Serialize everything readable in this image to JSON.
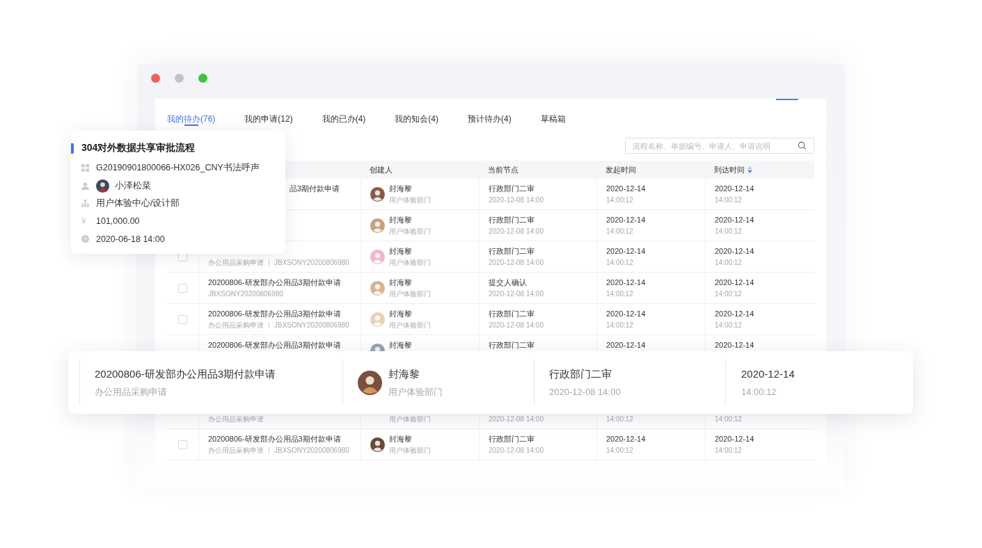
{
  "window": {
    "controls": [
      {
        "kind": "close"
      },
      {
        "kind": "minimize"
      },
      {
        "kind": "maximize"
      }
    ]
  },
  "tabs": [
    {
      "label": "我的待办(76)",
      "selected": true
    },
    {
      "label": "我的申请(12)",
      "selected": false
    },
    {
      "label": "我的已办(4)",
      "selected": false
    },
    {
      "label": "我的知会(4)",
      "selected": false
    },
    {
      "label": "预计待办(4)",
      "selected": false
    },
    {
      "label": "草稿箱",
      "selected": false
    }
  ],
  "search": {
    "placeholder": "流程名称、单据编号、申请人、申请说明"
  },
  "table": {
    "columns": [
      {
        "label": "创建人"
      },
      {
        "label": "当前节点"
      },
      {
        "label": "发起时间"
      },
      {
        "label": "到达时间",
        "sortable": true
      }
    ],
    "rows": [
      {
        "kind": "cut",
        "title": "品3期付款申请",
        "creator": "封海黎",
        "dept": "用户体验部门",
        "node": "行政部门二审",
        "node_time": "2020-12-08 14:00",
        "start_date": "2020-12-14",
        "start_time": "14:00:12",
        "arrive_date": "2020-12-14",
        "arrive_time": "14:00:12"
      },
      {
        "kind": "normal",
        "creator": "封海黎",
        "dept": "用户体验部门",
        "node": "行政部门二审",
        "node_time": "2020-12-08 14:00",
        "start_date": "2020-12-14",
        "start_time": "14:00:12",
        "arrive_date": "2020-12-14",
        "arrive_time": "14:00:12"
      },
      {
        "kind": "normal",
        "checked": false,
        "category": "办公用品采购申请",
        "code": "JBXSONY20200806980",
        "creator": "封海黎",
        "dept": "用户体验部门",
        "node": "行政部门二审",
        "node_time": "2020-12-08 14:00",
        "start_date": "2020-12-14",
        "start_time": "14:00:12",
        "arrive_date": "2020-12-14",
        "arrive_time": "14:00:12"
      },
      {
        "kind": "normal",
        "checked": false,
        "title": "20200806-研发部办公用品3期付款申请",
        "code": "JBXSONY20200806980",
        "creator": "封海黎",
        "dept": "用户体验部门",
        "node": "提交人确认",
        "node_time": "2020-12-08 14:00",
        "start_date": "2020-12-14",
        "start_time": "14:00:12",
        "arrive_date": "2020-12-14",
        "arrive_time": "14:00:12"
      },
      {
        "kind": "normal",
        "checked": false,
        "title": "20200806-研发部办公用品3期付款申请",
        "category": "办公用品采购申请",
        "code": "JBXSONY20200806980",
        "creator": "封海黎",
        "dept": "用户体验部门",
        "node": "行政部门二审",
        "node_time": "2020-12-08 14:00",
        "start_date": "2020-12-14",
        "start_time": "14:00:12",
        "arrive_date": "2020-12-14",
        "arrive_time": "14:00:12"
      },
      {
        "kind": "normal",
        "title": "20200806-研发部办公用品3期付款申请",
        "creator": "封海黎",
        "node": "行政部门二审",
        "start_date": "2020-12-14",
        "arrive_date": "2020-12-14"
      },
      {
        "kind": "after_gap",
        "category": "办公用品采购申请",
        "dept": "用户体验部门",
        "node_time": "2020-12-08 14:00",
        "start_time": "14:00:12",
        "arrive_time": "14:00:12"
      },
      {
        "kind": "normal",
        "checked": false,
        "title": "20200806-研发部办公用品3期付款申请",
        "category": "办公用品采购申请",
        "code": "JBXSONY20200806980",
        "creator": "封海黎",
        "dept": "用户体验部门",
        "node": "行政部门二审",
        "node_time": "2020-12-08 14:00",
        "start_date": "2020-12-14",
        "start_time": "14:00:12",
        "arrive_date": "2020-12-14",
        "arrive_time": "14:00:12"
      }
    ]
  },
  "detail_card": {
    "title": "304对外数据共享审批流程",
    "number": "G20190901800066-HX026_CNY书法呼声",
    "applicant": "小泽松菜",
    "department": "用户体验中心/设计部",
    "currency": "¥",
    "amount": "101,000.00",
    "time": "2020-06-18 14:00"
  },
  "highlight_row": {
    "title": "20200806-研发部办公用品3期付款申请",
    "category": "办公用品采购申请",
    "creator": "封海黎",
    "dept": "用户体验部门",
    "node": "行政部门二审",
    "node_time": "2020-12-08 14:00",
    "date": "2020-12-14",
    "time": "14:00:12"
  }
}
